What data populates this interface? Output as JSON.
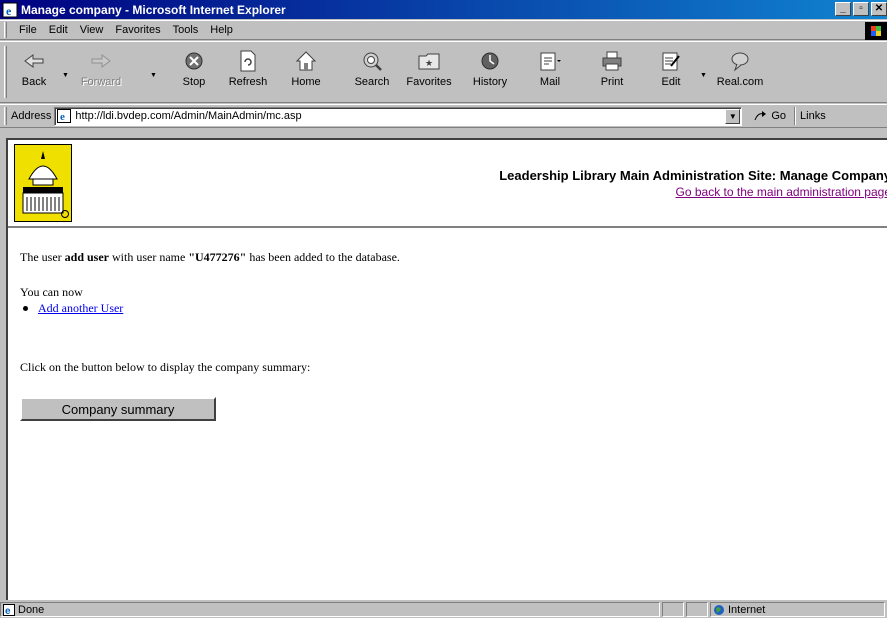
{
  "window": {
    "title": "Manage company - Microsoft Internet Explorer"
  },
  "menu": [
    "File",
    "Edit",
    "View",
    "Favorites",
    "Tools",
    "Help"
  ],
  "toolbar": {
    "back": "Back",
    "forward": "Forward",
    "stop": "Stop",
    "refresh": "Refresh",
    "home": "Home",
    "search": "Search",
    "favorites": "Favorites",
    "history": "History",
    "mail": "Mail",
    "print": "Print",
    "edit": "Edit",
    "realcom": "Real.com"
  },
  "address": {
    "label": "Address",
    "url": "http://ldi.bvdep.com/Admin/MainAdmin/mc.asp",
    "go": "Go",
    "links": "Links"
  },
  "page": {
    "site_title": "Leadership Library Main Administration Site: Manage Company",
    "back_link": "Go back to the main administration page",
    "msg_prefix": "The user ",
    "msg_user": "add user",
    "msg_middle": " with user name ",
    "msg_username": "\"U477276\"",
    "msg_suffix": " has been added to the database.",
    "you_can_now": "You can now",
    "add_another": "Add another User",
    "click_text": "Click on the button below to display the company summary:",
    "summary_button": "Company summary"
  },
  "status": {
    "text": "Done",
    "zone": "Internet"
  }
}
